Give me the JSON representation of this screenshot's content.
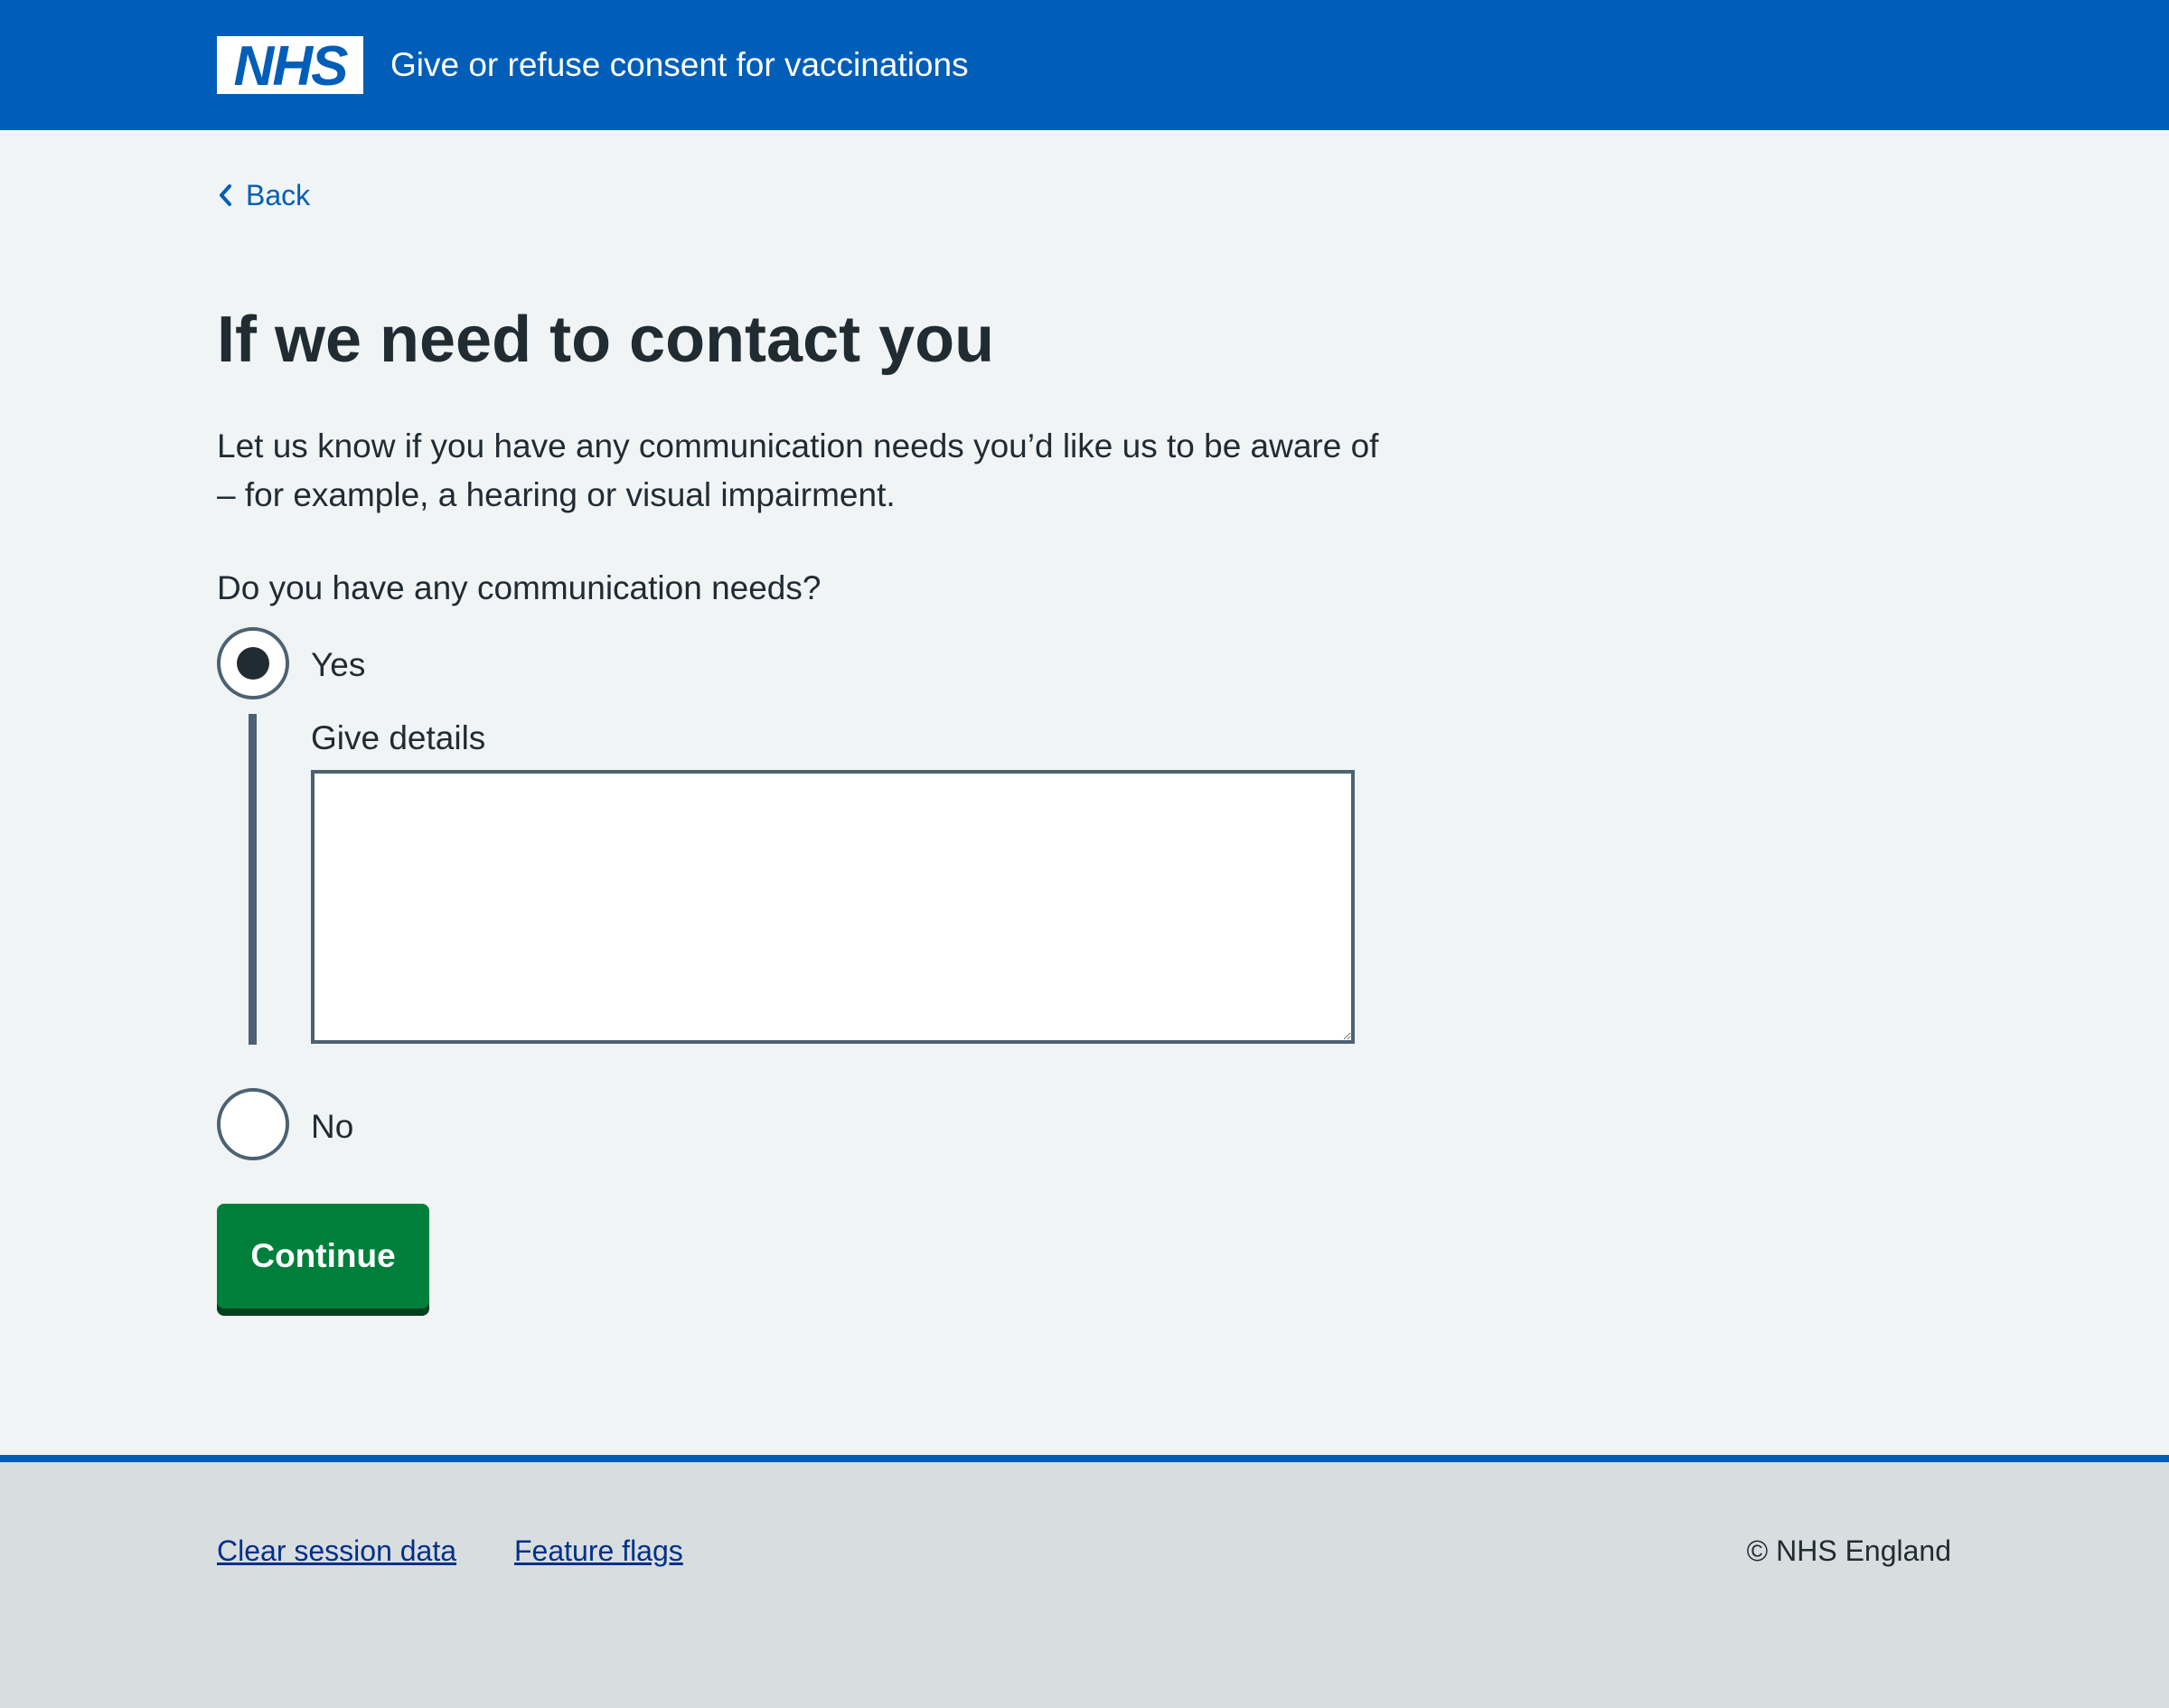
{
  "header": {
    "logo_text": "NHS",
    "service_name": "Give or refuse consent for vaccinations"
  },
  "back_link": {
    "label": "Back",
    "icon": "chevron-left-icon"
  },
  "main": {
    "title": "If we need to contact you",
    "intro": "Let us know if you have any communication needs you’d like us to be aware of – for example, a hearing or visual impairment.",
    "question": "Do you have any communication needs?",
    "options": [
      {
        "label": "Yes",
        "selected": true
      },
      {
        "label": "No",
        "selected": false
      }
    ],
    "details": {
      "label": "Give details",
      "value": ""
    },
    "continue_label": "Continue"
  },
  "footer": {
    "links": [
      "Clear session data",
      "Feature flags"
    ],
    "copyright": "© NHS England"
  },
  "colors": {
    "header_blue": "#005eb8",
    "page_background": "#f0f4f5",
    "text": "#212b32",
    "link": "#005eb8",
    "footer_link": "#003087",
    "border": "#4c6272",
    "button_green": "#007f3b",
    "button_shadow": "#00401e",
    "footer_background": "#d8dde0"
  }
}
